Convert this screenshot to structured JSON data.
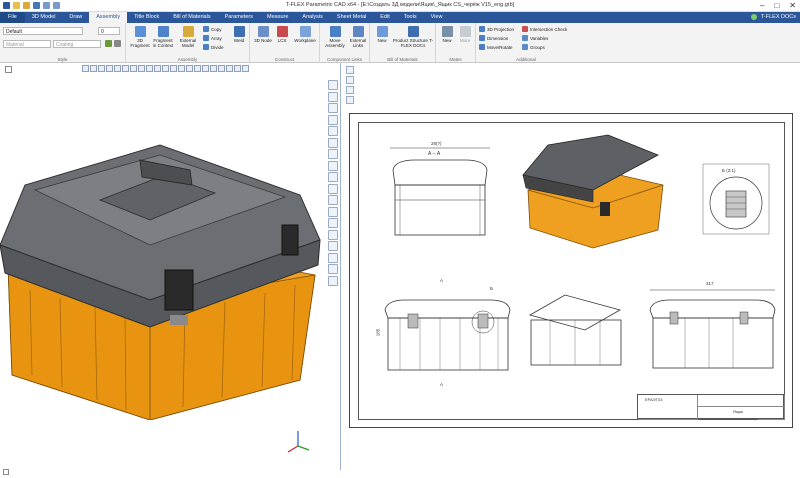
{
  "window": {
    "title": "T-FLEX Parametric CAD x64 - [E:\\Создать 3Д модели\\Яцик\\_Ящик CS_черёж V15_eng.grb]",
    "controls": [
      "–",
      "□",
      "✕"
    ]
  },
  "menu": {
    "tabs": [
      "File",
      "3D Model",
      "Draw",
      "Assembly",
      "Title Block",
      "Bill of Materials",
      "Parameters",
      "Measure",
      "Analysis",
      "Sheet Metal",
      "Edit",
      "Tools",
      "View"
    ],
    "active": "Assembly",
    "docs_label": "T-FLEX DOCs"
  },
  "ribbon": {
    "style": {
      "label": "Style",
      "layer_value": "Default",
      "layer_number": "0",
      "material_placeholder": "Material",
      "coating_placeholder": "Coating"
    },
    "assembly": {
      "label": "Assembly",
      "fragment3d": "3D Fragment",
      "fragment_in_context": "Fragment in Context",
      "external_model": "External Model",
      "copy": "Copy",
      "array": "Array",
      "divide": "Divide",
      "weld": "Weld"
    },
    "construct": {
      "label": "Construct",
      "node3d": "3D Node",
      "lcs": "LCS",
      "workplane": "Workplane"
    },
    "component_links": {
      "label": "Component Links",
      "move_assembly": "Move Assembly",
      "external_links": "External Links"
    },
    "bom": {
      "label": "Bill of Materials",
      "new": "New",
      "product_structure": "Product Structure T-FLEX DOCs"
    },
    "mates": {
      "label": "Mates",
      "new": "New",
      "more": "More"
    },
    "additional": {
      "label": "Additional",
      "projection": "3D Projection",
      "dimension": "Dimension",
      "move_rotate": "Move/Rotate",
      "intersection": "Intersection Check",
      "variables": "Variables",
      "groups": "Groups"
    }
  },
  "drawing": {
    "section_label": "А – А",
    "detail_label": "Б (2:1)",
    "dim_width_top": "28(?)",
    "dim_width_front": "317",
    "dim_height_front": "185",
    "marker_a_top": "А",
    "marker_a_bottom": "А",
    "marker_b": "Б"
  },
  "title_block": {
    "name": "ЕРАЭТ03",
    "designation": "Ящик"
  },
  "colors": {
    "ribbon_blue": "#2b579a",
    "box_orange": "#f0a020",
    "lid_gray": "#6b6e72"
  }
}
